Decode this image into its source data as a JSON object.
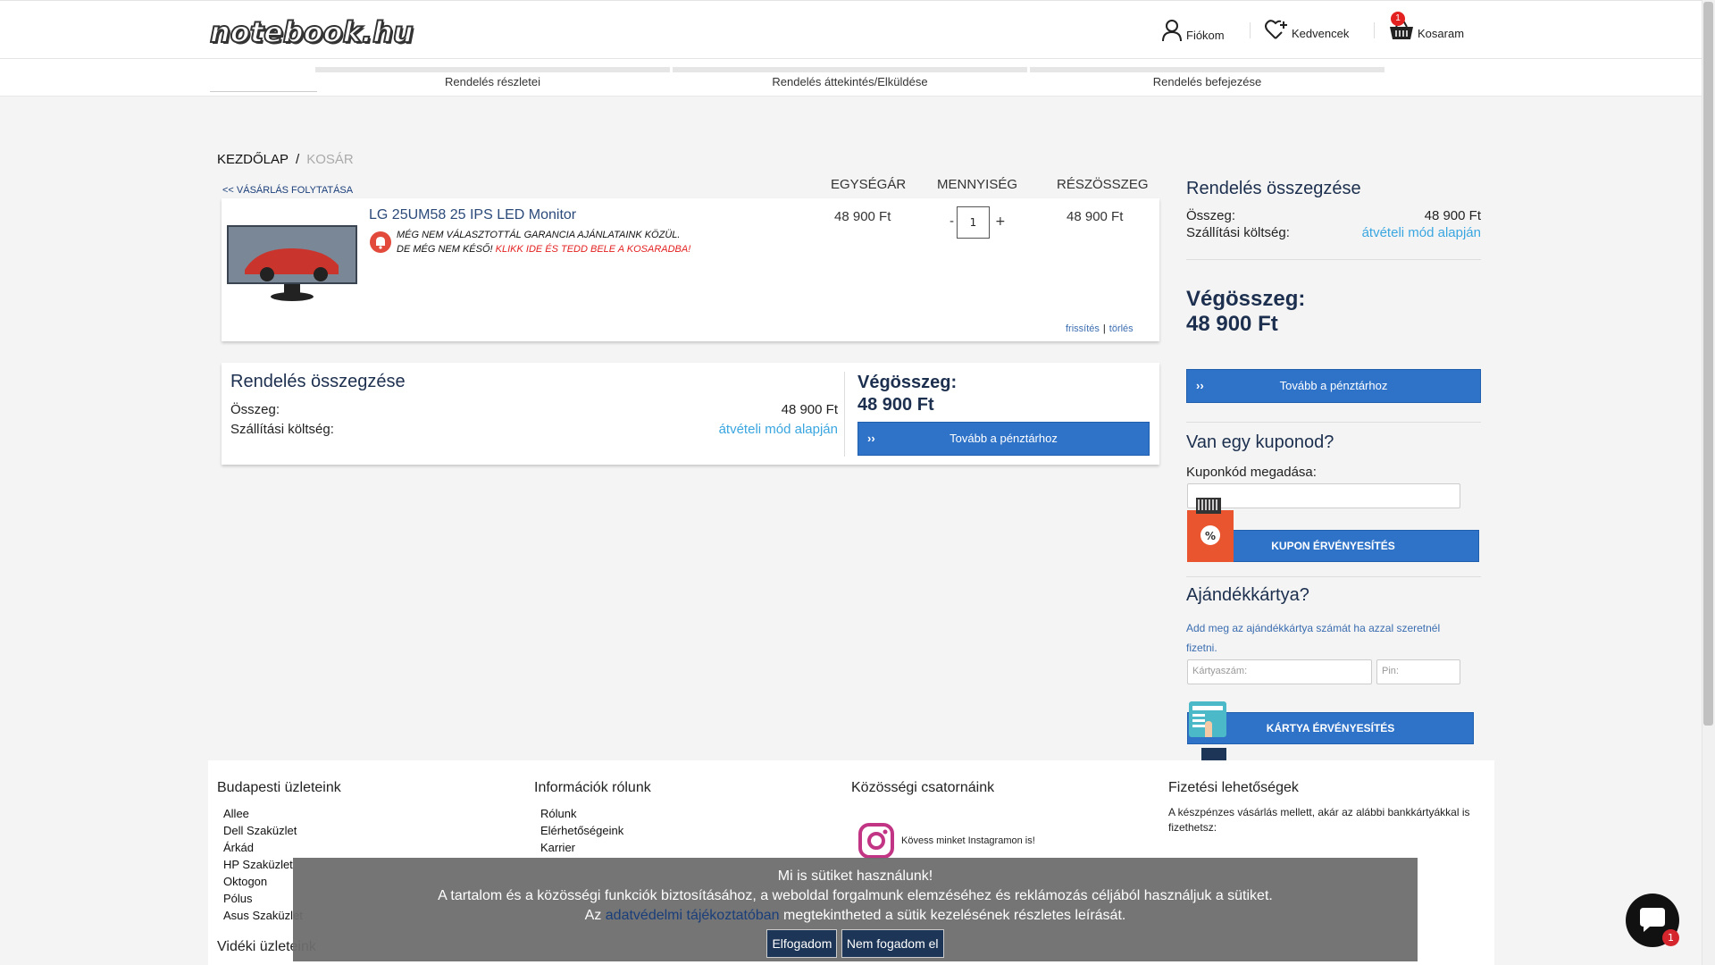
{
  "header": {
    "logo_text": "notebook.hu",
    "account_label": "Fiókom",
    "favorites_label": "Kedvencek",
    "cart_label": "Kosaram",
    "cart_count": "1"
  },
  "steps": [
    "Rendelés részletei",
    "Rendelés áttekintés/Elküldése",
    "Rendelés befejezése"
  ],
  "breadcrumb": {
    "home": "KEZDŐLAP",
    "sep": "/",
    "current": "KOSÁR"
  },
  "cart": {
    "continue_link": "<< VÁSÁRLÁS FOLYTATÁSA",
    "columns": {
      "unit_price": "EGYSÉGÁR",
      "quantity": "MENNYISÉG",
      "subtotal": "RÉSZÖSSZEG"
    },
    "item": {
      "name": "LG 25UM58 25 IPS LED Monitor",
      "warning_line1": "MÉG NEM VÁLASZTOTTÁL GARANCIA AJÁNLATAINK KÖZÜL.",
      "warning_line2_a": "DE MÉG NEM KÉSŐ!",
      "warning_line2_b": "KLIKK IDE ÉS TEDD BELE A KOSARADBA!",
      "unit_price": "48 900 Ft",
      "quantity": "1",
      "minus": "-",
      "plus": "+",
      "subtotal": "48 900 Ft",
      "refresh_link": "frissítés",
      "delete_link": "törlés"
    }
  },
  "summary": {
    "title": "Rendelés összegzése",
    "sum_label": "Összeg:",
    "sum_value": "48 900 Ft",
    "shipping_label": "Szállítási költség:",
    "shipping_value": "átvételi mód alapján",
    "total_label": "Végösszeg:",
    "total_value": "48 900 Ft",
    "checkout_button": "Tovább a pénztárhoz",
    "arrow": "››"
  },
  "coupon": {
    "title": "Van egy kuponod?",
    "label": "Kuponkód megadása:",
    "button": "KUPON ÉRVÉNYESÍTÉS"
  },
  "giftcard": {
    "title": "Ajándékkártya?",
    "description": "Add meg az ajándékkártya számát ha azzal szeretnél fizetni.",
    "card_placeholder": "Kártyaszám:",
    "pin_placeholder": "Pin:",
    "button": "KÁRTYA ÉRVÉNYESÍTÉS"
  },
  "footer": {
    "stores_title": "Budapesti üzleteink",
    "stores": [
      "Allee",
      "Dell Szaküzlet",
      "Árkád",
      "HP Szaküzlet",
      "Oktogon",
      "Pólus",
      "Asus Szaküzlet"
    ],
    "rural_title": "Vidéki üzleteink",
    "info_title": "Információk rólunk",
    "info": [
      "Rólunk",
      "Elérhetőségeink",
      "Karrier"
    ],
    "social_title": "Közösségi csatornáink",
    "instagram_text": "Kövess minket Instagramon is!",
    "payment_title": "Fizetési lehetőségek",
    "payment_text": "A készpénzes vásárlás mellett, akár az alábbi bankkártyákkal is fizethetsz:"
  },
  "cookie": {
    "title": "Mi is sütiket használunk!",
    "line1": "A tartalom és a közösségi funkciók biztosításához, a weboldal forgalmunk elemzéséhez és reklámozás céljából használjuk a sütiket.",
    "line2_a": "Az",
    "line2_link": "adatvédelmi tájékoztatóban",
    "line2_b": "megtekintheted a sütik kezelésének részletes leírását.",
    "accept": "Elfogadom",
    "decline": "Nem fogadom el"
  },
  "chat": {
    "badge": "1"
  },
  "colors": {
    "primary_blue": "#2f73c9",
    "accent": "#3aa6e0",
    "warning_red": "#e32121",
    "navy": "#1c2f4e"
  }
}
